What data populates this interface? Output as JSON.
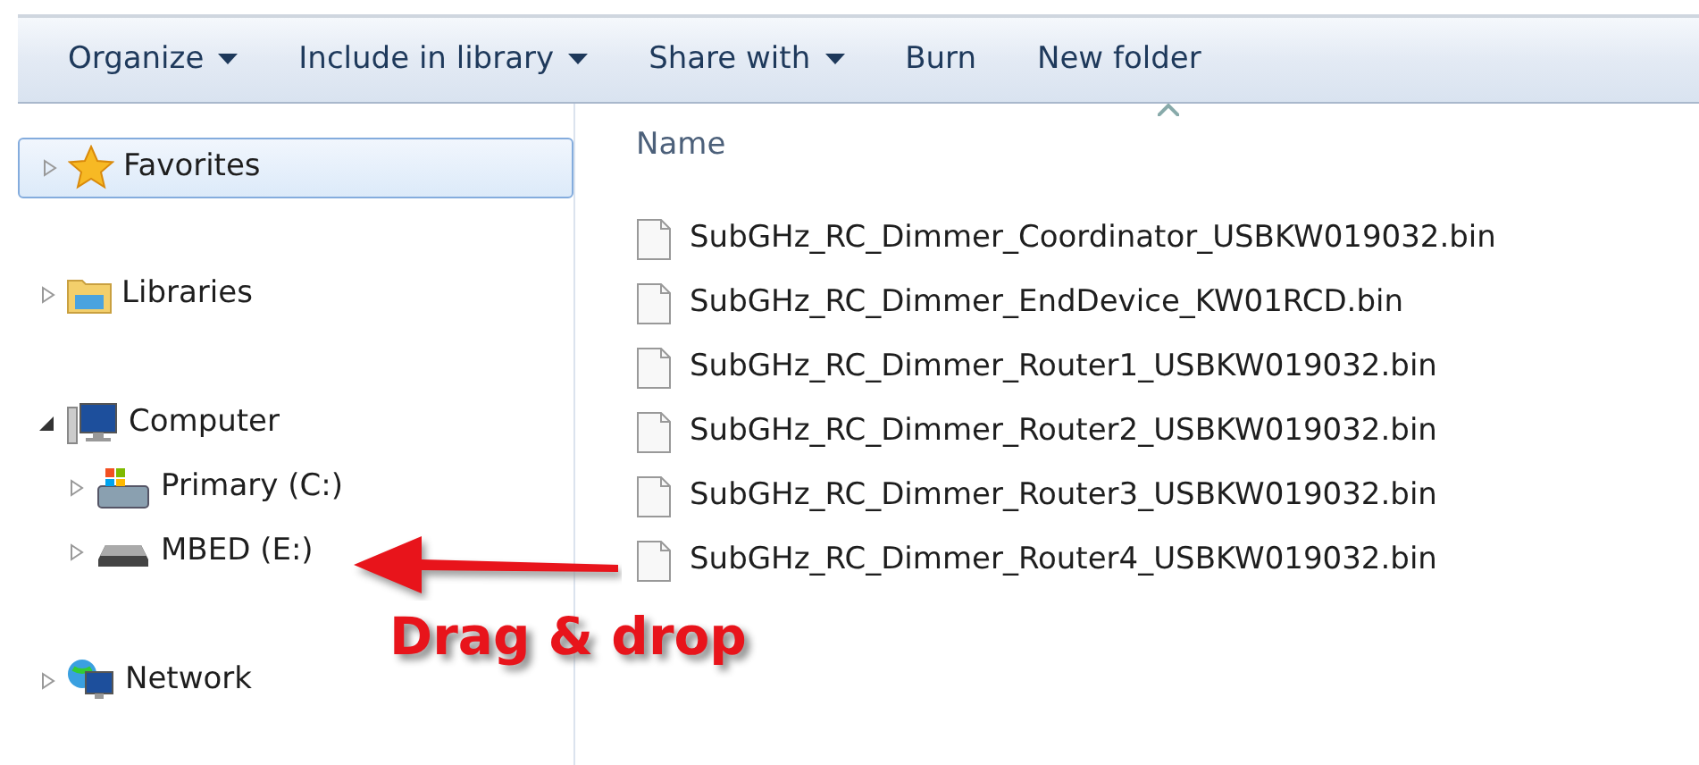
{
  "toolbar": [
    {
      "label": "Organize",
      "has_menu": true
    },
    {
      "label": "Include in library",
      "has_menu": true
    },
    {
      "label": "Share with",
      "has_menu": true
    },
    {
      "label": "Burn",
      "has_menu": false
    },
    {
      "label": "New folder",
      "has_menu": false
    }
  ],
  "navigation": [
    {
      "label": "Favorites",
      "selected": true,
      "expanded": false
    },
    {
      "label": "Libraries",
      "selected": false,
      "expanded": false
    },
    {
      "label": "Computer",
      "selected": false,
      "expanded": true,
      "children": [
        {
          "label": "Primary (C:)",
          "selected": false,
          "expanded": false
        },
        {
          "label": "MBED (E:)",
          "selected": false,
          "expanded": false
        }
      ]
    },
    {
      "label": "Network",
      "selected": false,
      "expanded": false
    }
  ],
  "file_list": {
    "columns": [
      {
        "label": "Name",
        "sort_indicator": true
      }
    ],
    "files": [
      {
        "name": "SubGHz_RC_Dimmer_Coordinator_USBKW019032.bin"
      },
      {
        "name": "SubGHz_RC_Dimmer_EndDevice_KW01RCD.bin"
      },
      {
        "name": "SubGHz_RC_Dimmer_Router1_USBKW019032.bin"
      },
      {
        "name": "SubGHz_RC_Dimmer_Router2_USBKW019032.bin"
      },
      {
        "name": "SubGHz_RC_Dimmer_Router3_USBKW019032.bin"
      },
      {
        "name": "SubGHz_RC_Dimmer_Router4_USBKW019032.bin"
      }
    ]
  },
  "annotation": {
    "text": "Drag & drop"
  }
}
